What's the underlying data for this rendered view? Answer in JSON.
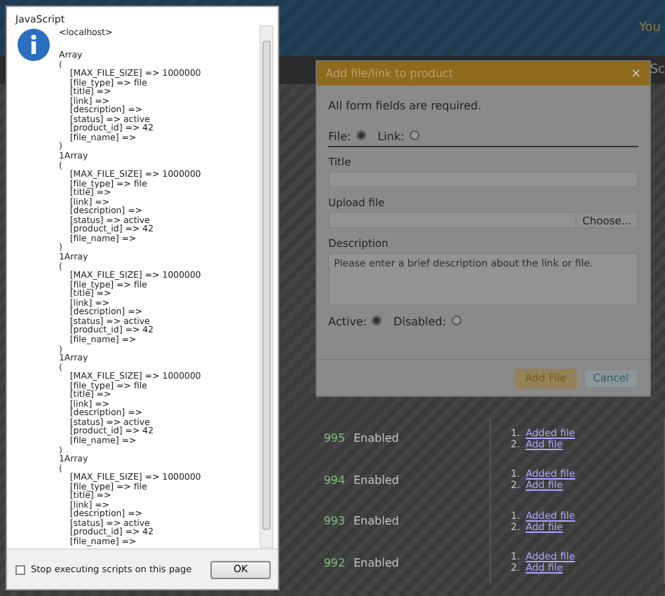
{
  "page": {
    "header_text": "You",
    "nav_text": "Sc",
    "rows": [
      {
        "number": "995",
        "status": "Enabled",
        "links": [
          {
            "number": "1.",
            "label": "Added file"
          },
          {
            "number": "2.",
            "label": "Add file"
          }
        ]
      },
      {
        "number": "994",
        "status": "Enabled",
        "links": [
          {
            "number": "1.",
            "label": "Added file"
          },
          {
            "number": "2.",
            "label": "Add file"
          }
        ]
      },
      {
        "number": "993",
        "status": "Enabled",
        "links": [
          {
            "number": "1.",
            "label": "Added file"
          },
          {
            "number": "2.",
            "label": "Add file"
          }
        ]
      },
      {
        "number": "992",
        "status": "Enabled",
        "links": [
          {
            "number": "1.",
            "label": "Added file"
          },
          {
            "number": "2.",
            "label": "Add file"
          }
        ]
      }
    ]
  },
  "modal": {
    "title": "Add file/link to product",
    "close": "×",
    "note": "All form fields are required.",
    "type_options": [
      {
        "label": "File:",
        "selected": true
      },
      {
        "label": "Link:",
        "selected": false
      }
    ],
    "title_label": "Title",
    "upload_label": "Upload file",
    "choose_button": "Choose...",
    "description_label": "Description",
    "description_placeholder": "Please enter a brief description about the link or file.",
    "status_options": [
      {
        "label": "Active:",
        "selected": true
      },
      {
        "label": "Disabled:",
        "selected": false
      }
    ],
    "buttons": [
      {
        "label": "Add File",
        "kind": "primary"
      },
      {
        "label": "Cancel",
        "kind": "secondary"
      }
    ]
  },
  "alert": {
    "title": "JavaScript",
    "origin": "<localhost>",
    "message": "Array\n(\n    [MAX_FILE_SIZE] => 1000000\n    [file_type] => file\n    [title] =>\n    [link] =>\n    [description] =>\n    [status] => active\n    [product_id] => 42\n    [file_name] =>\n)\n1Array\n(\n    [MAX_FILE_SIZE] => 1000000\n    [file_type] => file\n    [title] =>\n    [link] =>\n    [description] =>\n    [status] => active\n    [product_id] => 42\n    [file_name] =>\n)\n1Array\n(\n    [MAX_FILE_SIZE] => 1000000\n    [file_type] => file\n    [title] =>\n    [link] =>\n    [description] =>\n    [status] => active\n    [product_id] => 42\n    [file_name] =>\n)\n1Array\n(\n    [MAX_FILE_SIZE] => 1000000\n    [file_type] => file\n    [title] =>\n    [link] =>\n    [description] =>\n    [status] => active\n    [product_id] => 42\n    [file_name] =>\n)\n1Array\n(\n    [MAX_FILE_SIZE] => 1000000\n    [file_type] => file\n    [title] =>\n    [link] =>\n    [description] =>\n    [status] => active\n    [product_id] => 42\n    [file_name] =>",
    "stop_label": "Stop executing scripts on this page",
    "stop_checked": false,
    "ok": "OK"
  }
}
